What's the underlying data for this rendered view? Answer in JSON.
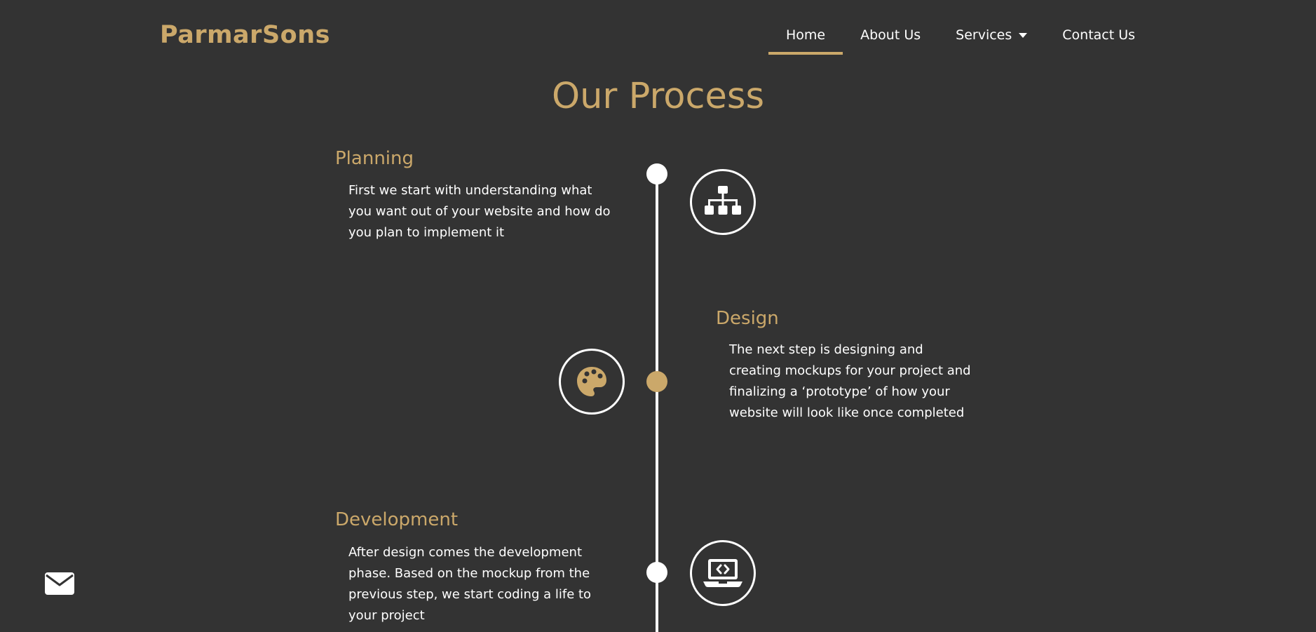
{
  "brand": {
    "name": "ParmarSons",
    "accent_color": "#cba86a",
    "background_color": "#333333"
  },
  "nav": {
    "items": [
      {
        "label": "Home",
        "active": true
      },
      {
        "label": "About Us",
        "active": false
      },
      {
        "label": "Services",
        "active": false,
        "has_dropdown": true
      },
      {
        "label": "Contact Us",
        "active": false
      }
    ]
  },
  "page": {
    "title": "Our Process"
  },
  "timeline": {
    "steps": [
      {
        "title": "Planning",
        "text": "First we start with understanding what you want out of your website and how do you plan to implement it",
        "icon": "sitemap-icon"
      },
      {
        "title": "Design",
        "text": "The next step is designing and creating mockups for your project and finalizing a ‘prototype’ of how your website will look like once completed",
        "icon": "palette-icon"
      },
      {
        "title": "Development",
        "text": "After design comes the development phase. Based on the mockup from the previous step, we start coding a life to your project",
        "icon": "laptop-code-icon"
      }
    ]
  },
  "floating": {
    "icon": "envelope-icon"
  }
}
